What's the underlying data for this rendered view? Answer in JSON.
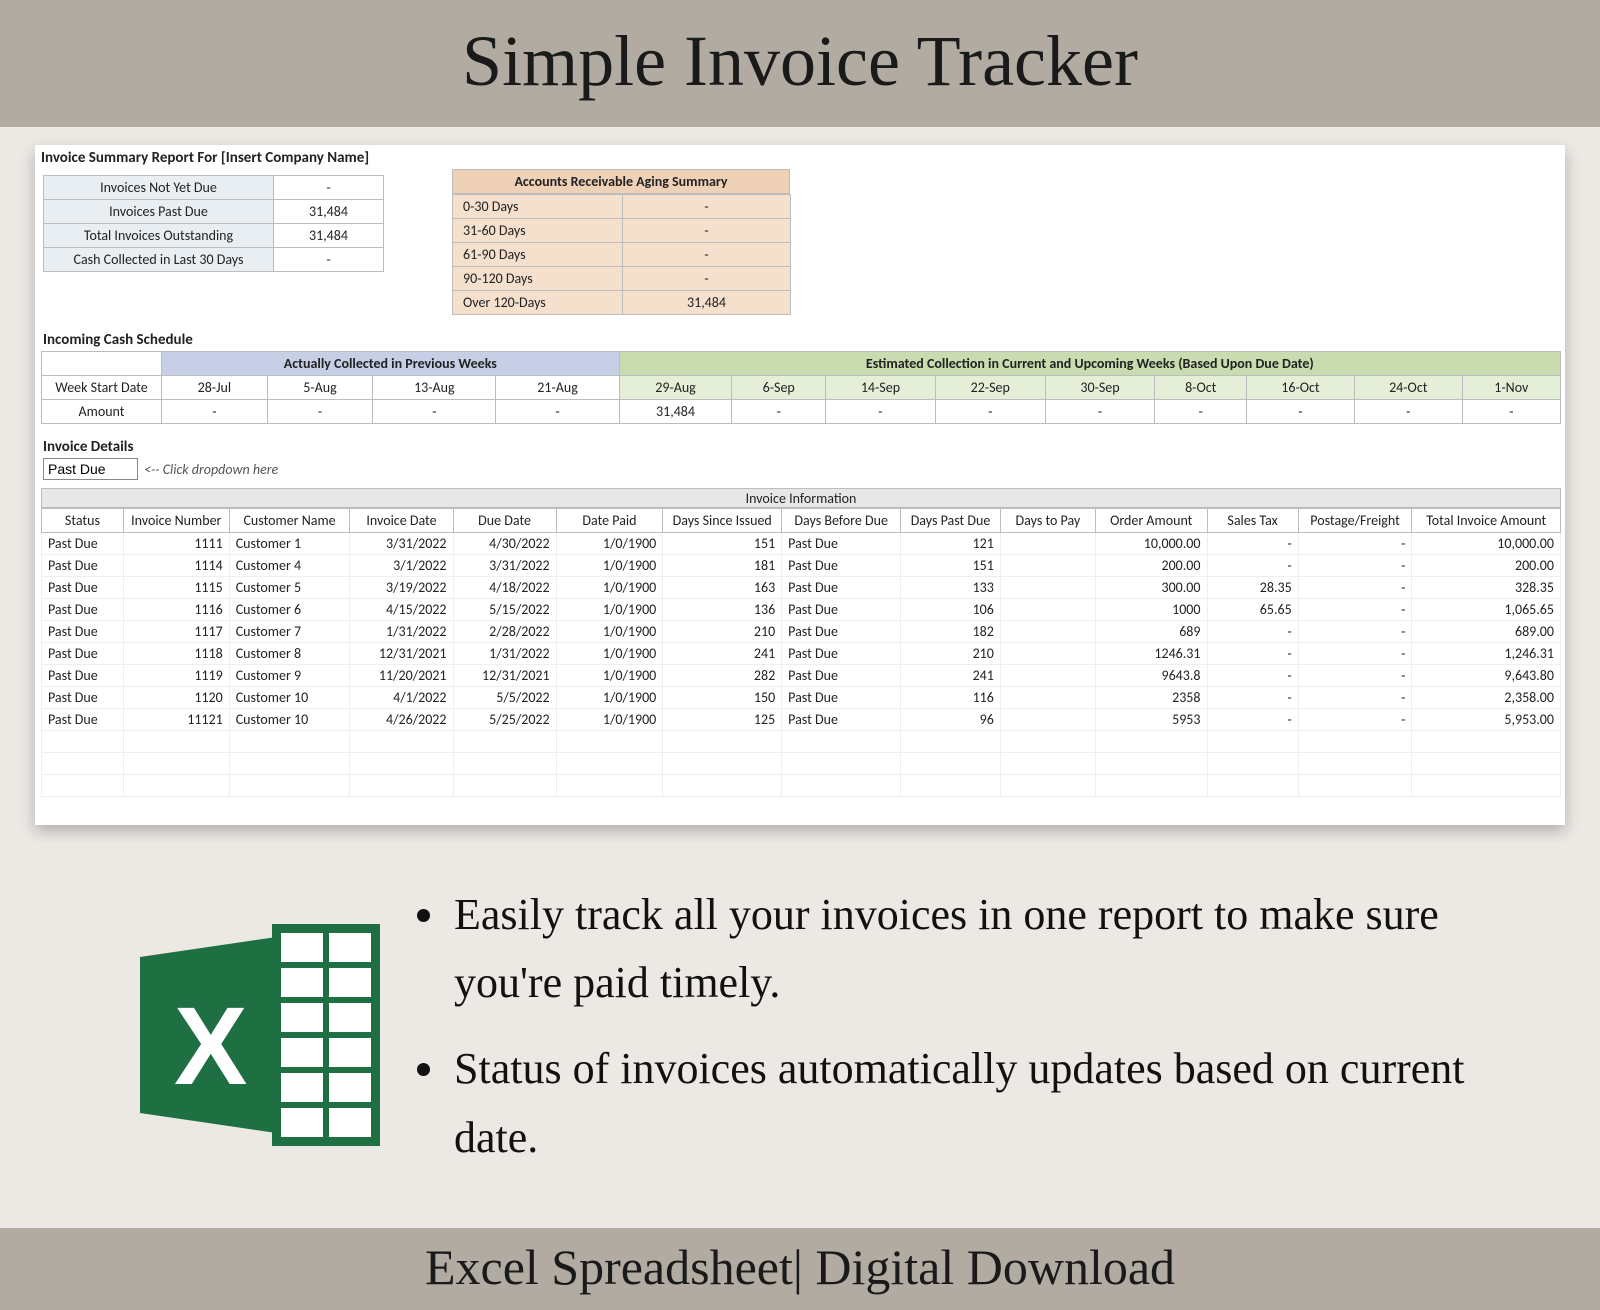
{
  "banners": {
    "top": "Simple Invoice Tracker",
    "bottom": "Excel Spreadsheet| Digital Download"
  },
  "report_title": "Invoice Summary Report For [Insert Company Name]",
  "summary": {
    "rows": [
      {
        "label": "Invoices Not Yet Due",
        "value": "-"
      },
      {
        "label": "Invoices Past Due",
        "value": "31,484"
      },
      {
        "label": "Total Invoices Outstanding",
        "value": "31,484"
      },
      {
        "label": "Cash Collected in Last 30 Days",
        "value": "-"
      }
    ]
  },
  "aging": {
    "title": "Accounts Receivable Aging Summary",
    "rows": [
      {
        "label": "0-30 Days",
        "value": "-"
      },
      {
        "label": "31-60 Days",
        "value": "-"
      },
      {
        "label": "61-90 Days",
        "value": "-"
      },
      {
        "label": "90-120 Days",
        "value": "-"
      },
      {
        "label": "Over 120-Days",
        "value": "31,484"
      }
    ]
  },
  "cash_schedule": {
    "title": "Incoming Cash Schedule",
    "prev_header": "Actually Collected in Previous Weeks",
    "est_header": "Estimated Collection in Current and Upcoming Weeks (Based Upon Due Date)",
    "row_labels": {
      "week": "Week Start Date",
      "amount": "Amount"
    },
    "prev_weeks": [
      "28-Jul",
      "5-Aug",
      "13-Aug",
      "21-Aug"
    ],
    "est_weeks": [
      "29-Aug",
      "6-Sep",
      "14-Sep",
      "22-Sep",
      "30-Sep",
      "8-Oct",
      "16-Oct",
      "24-Oct",
      "1-Nov"
    ],
    "prev_amounts": [
      "-",
      "-",
      "-",
      "-"
    ],
    "est_amounts": [
      "31,484",
      "-",
      "-",
      "-",
      "-",
      "-",
      "-",
      "-",
      "-"
    ]
  },
  "details": {
    "title": "Invoice Details",
    "filter_value": "Past Due",
    "filter_hint": "<-- Click dropdown here",
    "info_band": "Invoice Information",
    "columns": [
      "Status",
      "Invoice Number",
      "Customer Name",
      "Invoice Date",
      "Due Date",
      "Date Paid",
      "Days Since Issued",
      "Days Before Due",
      "Days Past Due",
      "Days to Pay",
      "Order Amount",
      "Sales Tax",
      "Postage/Freight",
      "Total Invoice Amount"
    ],
    "rows": [
      {
        "c": [
          "Past Due",
          "1111",
          "Customer 1",
          "3/31/2022",
          "4/30/2022",
          "1/0/1900",
          "151",
          "Past Due",
          "121",
          "",
          "10,000.00",
          "-",
          "-",
          "10,000.00"
        ]
      },
      {
        "c": [
          "Past Due",
          "1114",
          "Customer 4",
          "3/1/2022",
          "3/31/2022",
          "1/0/1900",
          "181",
          "Past Due",
          "151",
          "",
          "200.00",
          "-",
          "-",
          "200.00"
        ]
      },
      {
        "c": [
          "Past Due",
          "1115",
          "Customer 5",
          "3/19/2022",
          "4/18/2022",
          "1/0/1900",
          "163",
          "Past Due",
          "133",
          "",
          "300.00",
          "28.35",
          "-",
          "328.35"
        ]
      },
      {
        "c": [
          "Past Due",
          "1116",
          "Customer 6",
          "4/15/2022",
          "5/15/2022",
          "1/0/1900",
          "136",
          "Past Due",
          "106",
          "",
          "1000",
          "65.65",
          "-",
          "1,065.65"
        ]
      },
      {
        "c": [
          "Past Due",
          "1117",
          "Customer 7",
          "1/31/2022",
          "2/28/2022",
          "1/0/1900",
          "210",
          "Past Due",
          "182",
          "",
          "689",
          "-",
          "-",
          "689.00"
        ]
      },
      {
        "c": [
          "Past Due",
          "1118",
          "Customer 8",
          "12/31/2021",
          "1/31/2022",
          "1/0/1900",
          "241",
          "Past Due",
          "210",
          "",
          "1246.31",
          "-",
          "-",
          "1,246.31"
        ]
      },
      {
        "c": [
          "Past Due",
          "1119",
          "Customer 9",
          "11/20/2021",
          "12/31/2021",
          "1/0/1900",
          "282",
          "Past Due",
          "241",
          "",
          "9643.8",
          "-",
          "-",
          "9,643.80"
        ]
      },
      {
        "c": [
          "Past Due",
          "1120",
          "Customer 10",
          "4/1/2022",
          "5/5/2022",
          "1/0/1900",
          "150",
          "Past Due",
          "116",
          "",
          "2358",
          "-",
          "-",
          "2,358.00"
        ]
      },
      {
        "c": [
          "Past Due",
          "11121",
          "Customer 10",
          "4/26/2022",
          "5/25/2022",
          "1/0/1900",
          "125",
          "Past Due",
          "96",
          "",
          "5953",
          "-",
          "-",
          "5,953.00"
        ]
      }
    ]
  },
  "promo": {
    "bullets": [
      "Easily track all your invoices in one report to make sure you're paid timely.",
      "Status of invoices automatically updates based on current date."
    ]
  }
}
